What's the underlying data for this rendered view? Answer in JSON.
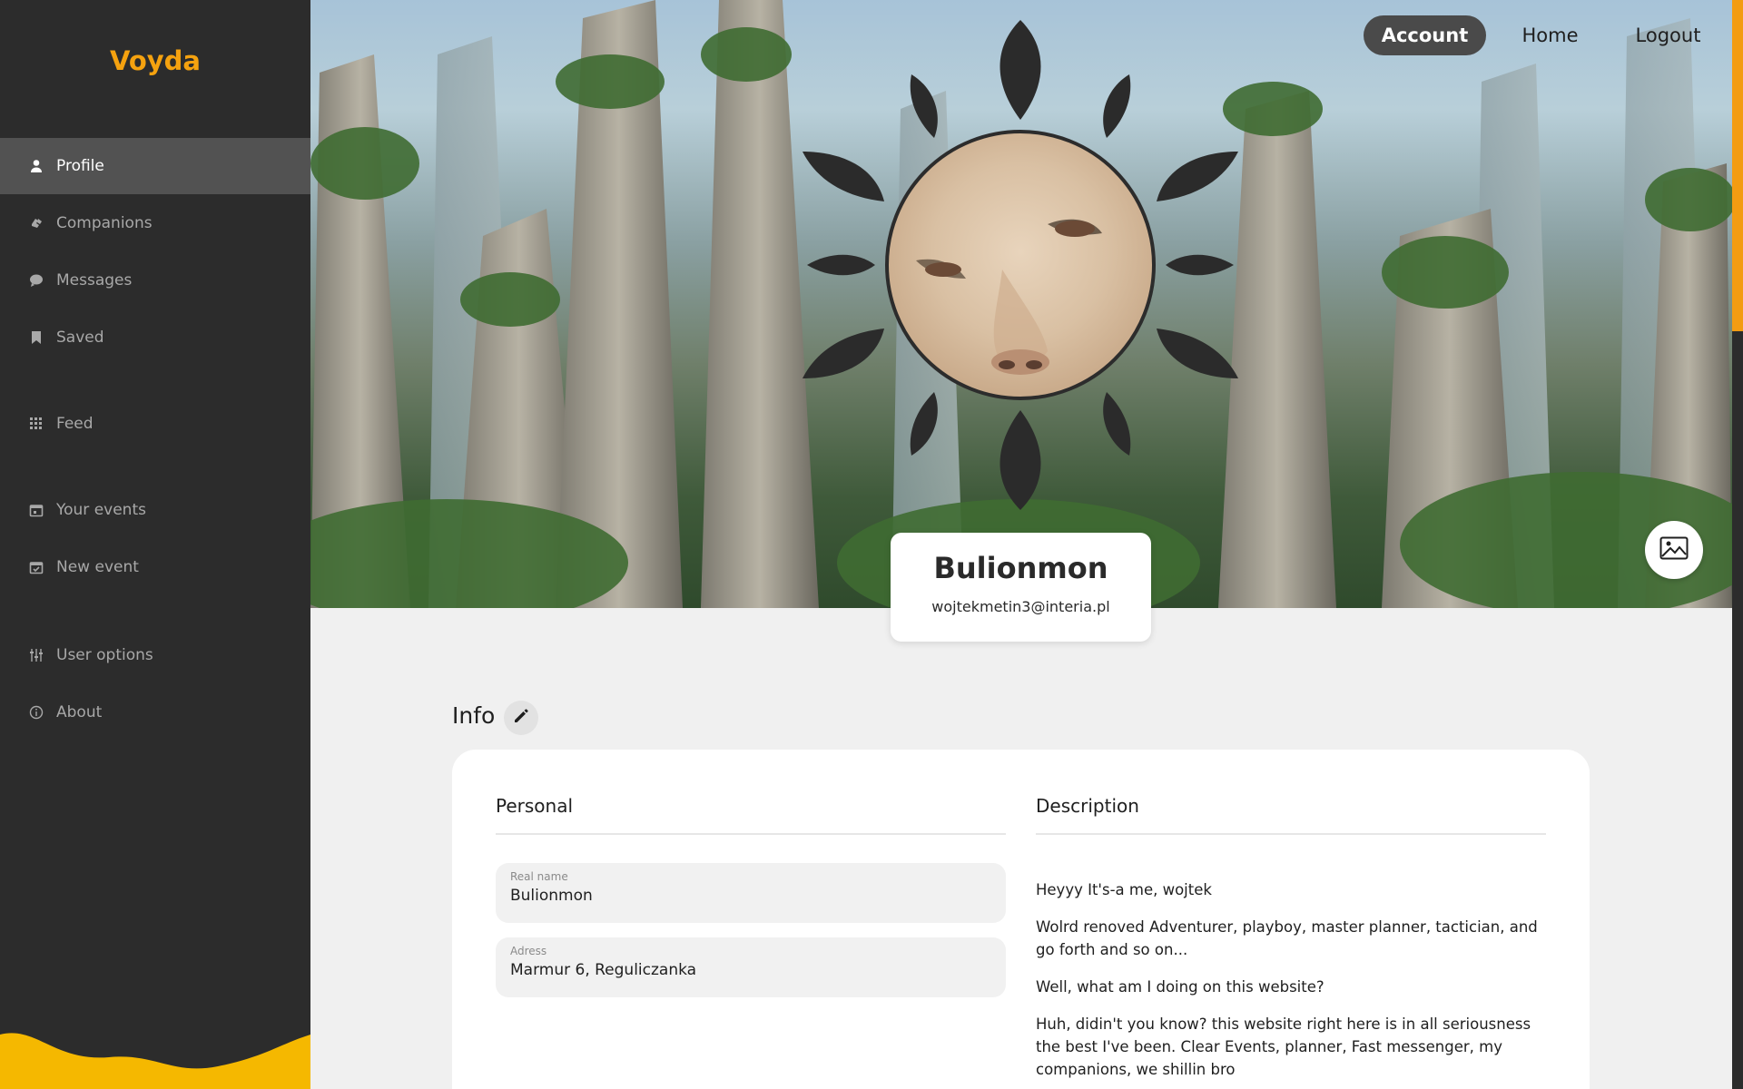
{
  "app": {
    "brand": "Voyda"
  },
  "sidebar": {
    "items": [
      {
        "label": "Profile",
        "icon": "user-icon"
      },
      {
        "label": "Companions",
        "icon": "handshake-icon"
      },
      {
        "label": "Messages",
        "icon": "chat-bubble-icon"
      },
      {
        "label": "Saved",
        "icon": "bookmark-icon"
      },
      {
        "label": "Feed",
        "icon": "grid-icon"
      },
      {
        "label": "Your events",
        "icon": "calendar-icon"
      },
      {
        "label": "New event",
        "icon": "calendar-check-icon"
      },
      {
        "label": "User options",
        "icon": "sliders-icon"
      },
      {
        "label": "About",
        "icon": "info-icon"
      }
    ],
    "active_item": "Profile"
  },
  "topnav": {
    "account": "Account",
    "home": "Home",
    "logout": "Logout",
    "active": "Account"
  },
  "profile": {
    "username": "Bulionmon",
    "email": "wojtekmetin3@interia.pl"
  },
  "info": {
    "title": "Info",
    "personal": {
      "title": "Personal",
      "fields": [
        {
          "label": "Real name",
          "value": "Bulionmon"
        },
        {
          "label": "Adress",
          "value": "Marmur 6, Reguliczanka"
        }
      ]
    },
    "description": {
      "title": "Description",
      "paragraphs": [
        "Heyyy It's-a me, wojtek",
        "Wolrd renoved Adventurer, playboy, master planner, tactician, and go forth and so on...",
        "Well, what am I doing on this website?",
        "Huh, didin't you know? this website right here is in all seriousness the best I've been. Clear Events, planner, Fast messenger, my companions, we shillin bro"
      ]
    }
  },
  "colors": {
    "accent": "#f5a20f",
    "sidebar_bg": "#2c2c2c",
    "active_nav": "#525252"
  }
}
